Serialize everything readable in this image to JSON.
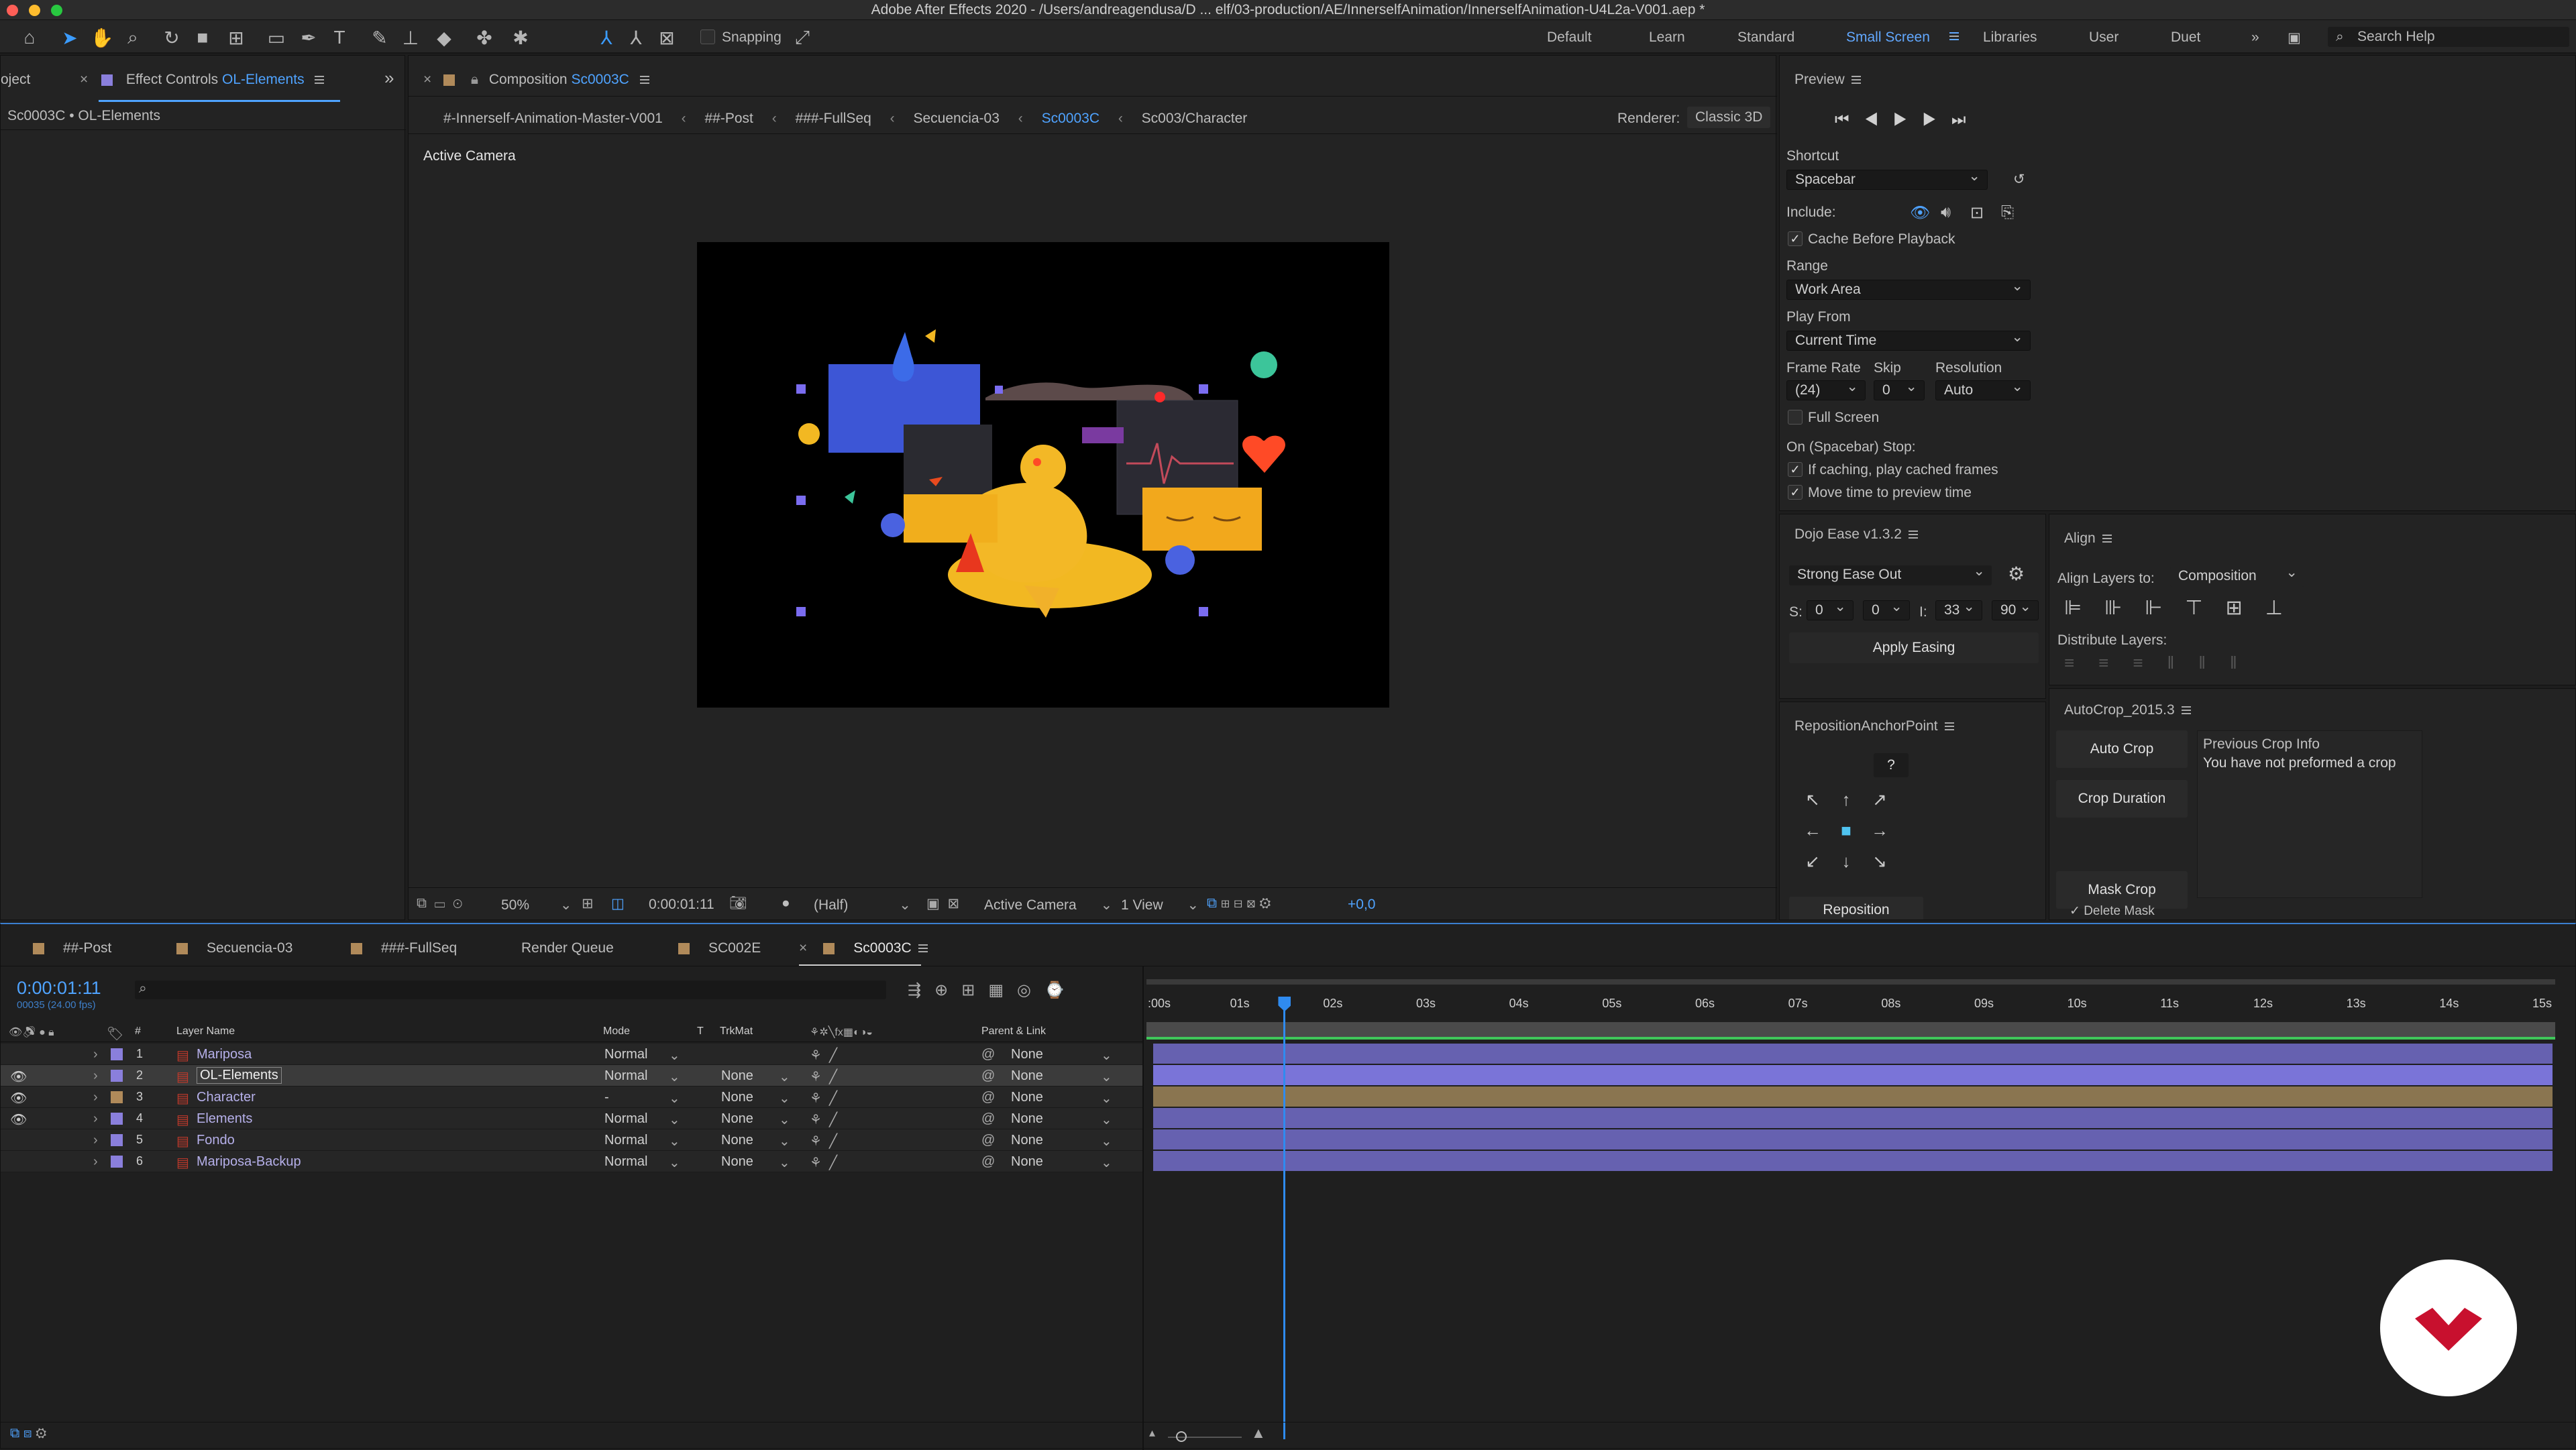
{
  "window": {
    "title": "Adobe After Effects 2020 - /Users/andreagendusa/D ... elf/03-production/AE/InnerselfAnimation/InnerselfAnimation-U4L2a-V001.aep *"
  },
  "toolbar": {
    "snapping_label": "Snapping",
    "workspaces": [
      "Default",
      "Learn",
      "Standard",
      "Small Screen",
      "Libraries",
      "User",
      "Duet"
    ],
    "active_workspace": "Small Screen",
    "search_placeholder": "Search Help"
  },
  "effect_controls": {
    "project_tab": "oject",
    "tab_label": "Effect Controls",
    "tab_layer": "OL-Elements",
    "subtitle": "Sc0003C • OL-Elements"
  },
  "composition": {
    "tab_label": "Composition",
    "tab_name": "Sc0003C",
    "breadcrumbs": [
      "#-Innerself-Animation-Master-V001",
      "##-Post",
      "###-FullSeq",
      "Secuencia-03",
      "Sc0003C",
      "Sc003/Character"
    ],
    "active_breadcrumb": "Sc0003C",
    "renderer_label": "Renderer:",
    "renderer_value": "Classic 3D",
    "view_label": "Active Camera",
    "footer": {
      "zoom": "50%",
      "timecode": "0:00:01:11",
      "resolution": "(Half)",
      "camera": "Active Camera",
      "views": "1 View",
      "exposure": "+0,0"
    }
  },
  "preview": {
    "title": "Preview",
    "shortcut_label": "Shortcut",
    "shortcut_value": "Spacebar",
    "include_label": "Include:",
    "cache_label": "Cache Before Playback",
    "range_label": "Range",
    "range_value": "Work Area",
    "play_from_label": "Play From",
    "play_from_value": "Current Time",
    "frame_rate_label": "Frame Rate",
    "skip_label": "Skip",
    "resolution_label": "Resolution",
    "frame_rate_value": "(24)",
    "skip_value": "0",
    "resolution_value": "Auto",
    "full_screen_label": "Full Screen",
    "on_stop_label": "On (Spacebar) Stop:",
    "if_caching_label": "If caching, play cached frames",
    "move_time_label": "Move time to preview time"
  },
  "dojo": {
    "title": "Dojo Ease v1.3.2",
    "preset": "Strong Ease Out",
    "s_label": "S:",
    "s1": "0",
    "s2": "0",
    "i_label": "I:",
    "i1": "33",
    "i2": "90",
    "apply_label": "Apply Easing"
  },
  "align": {
    "title": "Align",
    "align_to_label": "Align Layers to:",
    "align_to_value": "Composition",
    "distribute_label": "Distribute Layers:"
  },
  "reposition": {
    "title": "RepositionAnchorPoint",
    "help": "?",
    "button": "Reposition"
  },
  "autocrop": {
    "title": "AutoCrop_2015.3",
    "auto_crop": "Auto Crop",
    "crop_duration": "Crop Duration",
    "mask_crop": "Mask Crop",
    "delete_mask": "Delete Mask",
    "info_title": "Previous Crop Info",
    "info_text": "You have not preformed a crop"
  },
  "timeline": {
    "tabs": [
      {
        "label": "##-Post",
        "color": "#b08a5a"
      },
      {
        "label": "Secuencia-03",
        "color": "#b08a5a"
      },
      {
        "label": "###-FullSeq",
        "color": "#b08a5a"
      },
      {
        "label": "Render Queue",
        "color": ""
      },
      {
        "label": "SC002E",
        "color": "#b08a5a"
      },
      {
        "label": "Sc0003C",
        "color": "#b08a5a"
      }
    ],
    "timecode": "0:00:01:11",
    "frame_info": "00035 (24.00 fps)",
    "headers": {
      "num": "#",
      "layer_name": "Layer Name",
      "mode": "Mode",
      "t": "T",
      "trkmat": "TrkMat",
      "parent": "Parent & Link"
    },
    "ruler": [
      ":00s",
      "01s",
      "02s",
      "03s",
      "04s",
      "05s",
      "06s",
      "07s",
      "08s",
      "09s",
      "10s",
      "11s",
      "12s",
      "13s",
      "14s",
      "15s"
    ],
    "playhead_seconds": 1.46,
    "duration_seconds": 15,
    "layers": [
      {
        "num": "1",
        "name": "Mariposa",
        "mode": "Normal",
        "trkmat": "",
        "parent": "None",
        "color": "#8a7fdc",
        "bar": "#6661b0",
        "visible": false
      },
      {
        "num": "2",
        "name": "OL-Elements",
        "mode": "Normal",
        "trkmat": "None",
        "parent": "None",
        "color": "#8a7fdc",
        "bar": "#7a74d8",
        "visible": true
      },
      {
        "num": "3",
        "name": "Character",
        "mode": "-",
        "trkmat": "None",
        "parent": "None",
        "color": "#b08a5a",
        "bar": "#8a7550",
        "visible": true
      },
      {
        "num": "4",
        "name": "Elements",
        "mode": "Normal",
        "trkmat": "None",
        "parent": "None",
        "color": "#8a7fdc",
        "bar": "#6661b0",
        "visible": true
      },
      {
        "num": "5",
        "name": "Fondo",
        "mode": "Normal",
        "trkmat": "None",
        "parent": "None",
        "color": "#8a7fdc",
        "bar": "#6661b0",
        "visible": false
      },
      {
        "num": "6",
        "name": "Mariposa-Backup",
        "mode": "Normal",
        "trkmat": "None",
        "parent": "None",
        "color": "#8a7fdc",
        "bar": "#6661b0",
        "visible": false
      }
    ]
  },
  "colors": {
    "accent": "#4fa3ff",
    "logo_red": "#c8102e"
  }
}
